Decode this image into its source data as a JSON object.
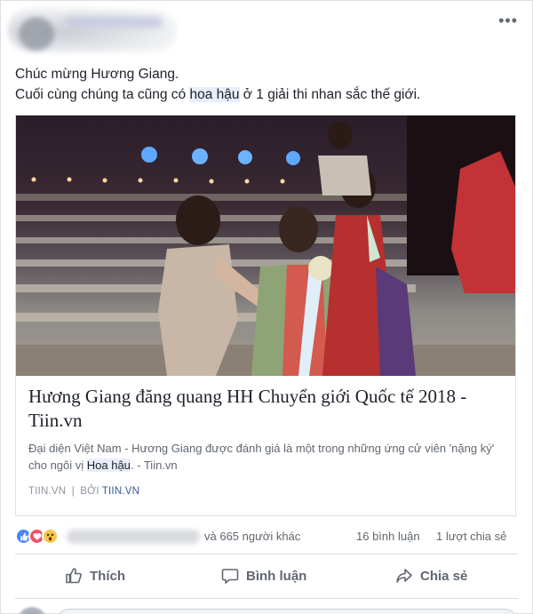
{
  "post": {
    "line1": "Chúc mừng Hương Giang.",
    "line2_before": "Cuối cùng chúng ta cũng có ",
    "line2_highlight": "hoa hậu",
    "line2_after": " ở 1 giải thi nhan sắc thế giới."
  },
  "link": {
    "title": "Hương Giang đăng quang HH Chuyển giới Quốc tế 2018 - Tiin.vn",
    "desc_before": "Đại diện Việt Nam - Hương Giang được đánh giá là một trong những ứng cử viên 'nặng ký' cho ngôi vị ",
    "desc_highlight": "Hoa hậu",
    "desc_after": ". - Tiin.vn",
    "source_domain": "TIIN.VN",
    "source_sep": "|",
    "source_by": "BỞI",
    "source_publisher": "TIIN.VN"
  },
  "reactions": {
    "others_text": "và 665 người khác",
    "comments_text": "16 bình luận",
    "shares_text": "1 lượt chia sẻ",
    "icons": [
      "like-reaction-icon",
      "love-reaction-icon",
      "wow-reaction-icon"
    ]
  },
  "actions": {
    "like_label": "Thích",
    "comment_label": "Bình luận",
    "share_label": "Chia sẻ"
  },
  "colors": {
    "link_blue": "#385898",
    "highlight_bg": "#e8eefa",
    "secondary_text": "#606770",
    "like_blue": "#4a86f7",
    "love_red": "#f25268",
    "wow_yellow": "#f7c64b"
  }
}
